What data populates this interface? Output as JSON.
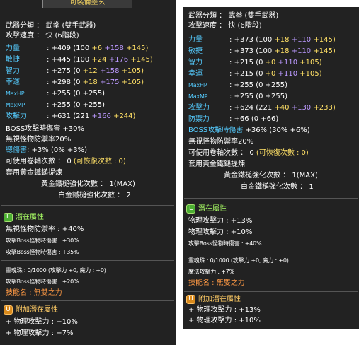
{
  "left": {
    "top_button": "可裝備靈玄",
    "weapon_type_label": "武器分類 ： 武拳 (雙手武器)",
    "attack_speed": "攻擊速度 ： 快 (6階段)",
    "stats": [
      {
        "name": "力量",
        "total": "+409",
        "base": "(100",
        "p1": "+6",
        "p2": "+158",
        "p3": "+145)"
      },
      {
        "name": "敏捷",
        "total": "+445",
        "base": "(100",
        "p1": "+24",
        "p2": "+176",
        "p3": "+145)"
      },
      {
        "name": "智力",
        "total": "+275",
        "base": "(0",
        "p1": "+12",
        "p2": "+158",
        "p3": "+105)"
      },
      {
        "name": "幸運",
        "total": "+298",
        "base": "(0",
        "p1": "+18",
        "p2": "+175",
        "p3": "+105)"
      }
    ],
    "maxhp": {
      "name": "MaxHP",
      "value": ": +255 (0 +255)"
    },
    "maxmp": {
      "name": "MaxMP",
      "value": ": +255 (0 +255)"
    },
    "attack": {
      "name": "攻擊力",
      "total": "+631",
      "base": "(221",
      "p1": "+166",
      "p2": "+244)"
    },
    "boss_damage": "BOSS攻擊時傷害 +30%",
    "ignore_def": "無視怪物防禦率20%",
    "total_damage": {
      "name": "總傷害",
      "value": ": +3% (0% +3%)"
    },
    "scroll_count": "可使用卷軸次數 ： 0",
    "scroll_recover": "(可恢復次數 : 0)",
    "golden_hammer": "套用黃金鐵鎚提煉",
    "gold_hammer_count": "黃金鐵槌強化次數 ： 1(MAX)",
    "platinum_hammer_count": "白金鐵槌強化次數 ： 2",
    "potential_title": "潛在屬性",
    "potential_lines": [
      "無視怪物防禦率 : +40%",
      "攻擊Boss怪物時傷害 : +30%",
      "攻擊Boss怪物時傷害 : +35%"
    ],
    "soul": "靈魂珠 : 0/1000 (攻擊力 +0, 魔力 : +0)",
    "soul_effect": "攻擊Boss怪物時傷害 : +20%",
    "skill": "技能名 : 無雙之力",
    "additional_title": "附加潛在屬性",
    "additional_lines": [
      "+ 物理攻擊力 : +10%",
      "+ 物理攻擊力 : +7%"
    ]
  },
  "right": {
    "weapon_type_label": "武器分類 ： 武拳 (雙手武器)",
    "attack_speed": "攻擊速度 ： 快 (6階段)",
    "stats": [
      {
        "name": "力量",
        "total": "+373",
        "base": "(100",
        "p1": "+18",
        "p2": "+110",
        "p3": "+145)"
      },
      {
        "name": "敏捷",
        "total": "+373",
        "base": "(100",
        "p1": "+18",
        "p2": "+110",
        "p3": "+145)"
      },
      {
        "name": "智力",
        "total": "+215",
        "base": "(0",
        "p1": "+0",
        "p2": "+110",
        "p3": "+105)"
      },
      {
        "name": "幸運",
        "total": "+215",
        "base": "(0",
        "p1": "+0",
        "p2": "+110",
        "p3": "+105)"
      }
    ],
    "maxhp": {
      "name": "MaxHP",
      "value": ": +255 (0 +255)"
    },
    "maxmp": {
      "name": "MaxMP",
      "value": ": +255 (0 +255)"
    },
    "attack": {
      "name": "攻擊力",
      "total": "+624",
      "base": "(221",
      "p1": "+40",
      "p2": "+130",
      "p3": "+233)"
    },
    "defense": {
      "name": "防禦力",
      "value": ": +66 (0 +66)"
    },
    "boss_damage": {
      "name": "BOSS攻擊時傷害",
      "value": "+36% (30% +6%)"
    },
    "ignore_def": "無視怪物防禦率20%",
    "scroll_count": "可使用卷軸次數 ： 0",
    "scroll_recover": "(可恢復次數 : 0)",
    "golden_hammer": "套用黃金鐵鎚提煉",
    "gold_hammer_count": "黃金鐵槌強化次數 ： 1(MAX)",
    "platinum_hammer_count": "白金鐵槌強化次數 ： 1",
    "potential_title": "潛在屬性",
    "potential_lines": [
      "物理攻擊力 : +13%",
      "物理攻擊力 : +10%",
      "攻擊Boss怪物時傷害 : +40%"
    ],
    "soul": "靈魂珠 : 0/1000 (攻擊力 +0, 魔力 : +0)",
    "soul_effect": "魔法攻擊力 : +7%",
    "skill": "技能名 : 無雙之力",
    "additional_title": "附加潛在屬性",
    "additional_lines": [
      "+ 物理攻擊力 : +13%",
      "+ 物理攻擊力 : +10%"
    ]
  }
}
